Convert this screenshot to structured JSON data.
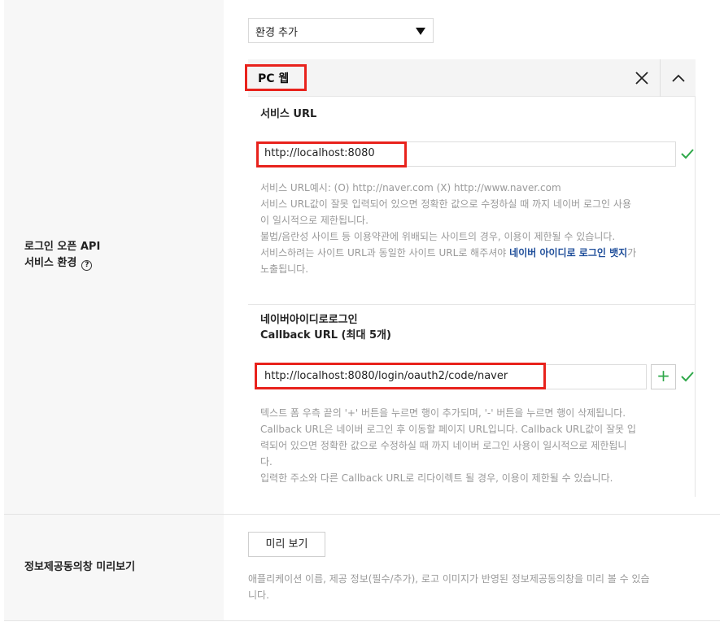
{
  "left": {
    "api_env_label_line1": "로그인 오픈 API",
    "api_env_label_line2": "서비스 환경",
    "help_glyph": "?",
    "preview_label": "정보제공동의창 미리보기"
  },
  "env_select": {
    "value": "환경 추가"
  },
  "panel": {
    "title": "PC 웹",
    "service_url": {
      "title": "서비스 URL",
      "value": "http://localhost:8080",
      "desc_lines": [
        "서비스 URL예시: (O) http://naver.com (X) http://www.naver.com",
        "서비스 URL값이 잘못 입력되어 있으면 정확한 값으로 수정하실 때 까지 네이버 로그인 사용",
        "이 일시적으로 제한됩니다.",
        "불법/음란성 사이트 등 이용약관에 위배되는 사이트의 경우, 이용이 제한될 수 있습니다."
      ],
      "desc_badge_prefix": "서비스하려는 사이트 URL과 동일한 사이트 URL로 해주셔야 ",
      "desc_badge_link": "네이버 아이디로 로그인 뱃지",
      "desc_badge_suffix": "가",
      "desc_last": "노출됩니다."
    },
    "callback": {
      "title_line1": "네이버아이디로로그인",
      "title_line2": "Callback URL (최대 5개)",
      "value": "http://localhost:8080/login/oauth2/code/naver",
      "add_glyph": "+",
      "desc_lines": [
        "텍스트 폼 우측 끝의 '+' 버튼을 누르면 행이 추가되며, '-' 버튼을 누르면 행이 삭제됩니다.",
        "Callback URL은 네이버 로그인 후 이동할 페이지 URL입니다. Callback URL값이 잘못 입",
        "력되어 있으면 정확한 값으로 수정하실 때 까지 네이버 로그인 사용이 일시적으로 제한됩니",
        "다.",
        "입력한 주소와 다른 Callback URL로 리다이렉트 될 경우, 이용이 제한될 수 있습니다."
      ]
    }
  },
  "preview": {
    "button_label": "미리 보기",
    "desc_line1": "애플리케이션 이름, 제공 정보(필수/추가), 로고 이미지가 반영된 정보제공동의창을 미리 볼 수 있습",
    "desc_line2": "니다."
  },
  "colors": {
    "highlight": "#e8221c",
    "check": "#2fa84a",
    "link": "#1f4e9a"
  },
  "icons": [
    "close-icon",
    "chevron-up-icon",
    "check-icon",
    "plus-icon",
    "help-icon",
    "caret-down-icon"
  ]
}
